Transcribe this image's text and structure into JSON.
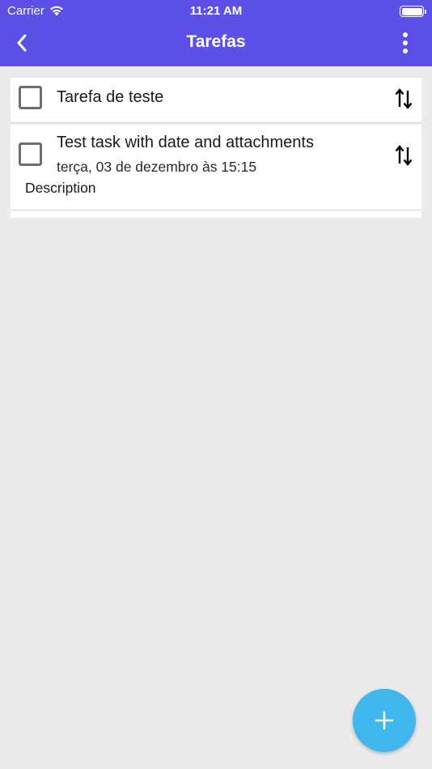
{
  "status_bar": {
    "carrier": "Carrier",
    "time": "11:21 AM",
    "battery_level": 1.0
  },
  "nav": {
    "title": "Tarefas",
    "back_icon": "chevron-left-icon",
    "menu_icon": "more-vertical-icon"
  },
  "tasks": [
    {
      "title": "Tarefa de teste",
      "checked": false
    },
    {
      "title": "Test task with date and attachments",
      "date": "terça, 03 de dezembro às 15:15",
      "description": "Description",
      "checked": false
    }
  ],
  "fab": {
    "icon": "plus-icon"
  },
  "colors": {
    "header": "#5c50e6",
    "background": "#ebebeb",
    "fab": "#3fb6ec"
  }
}
